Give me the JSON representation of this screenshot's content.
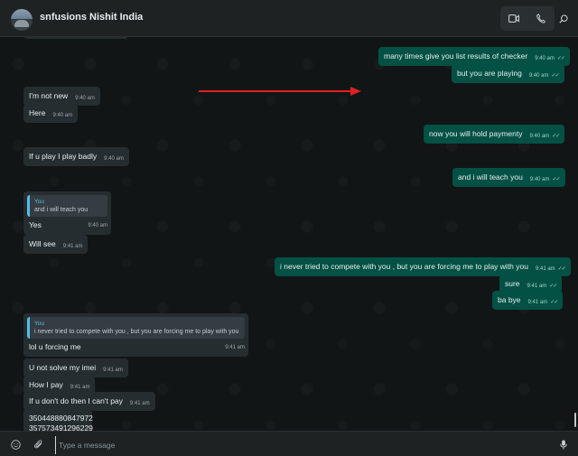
{
  "header": {
    "contact_name": "snfusions Nishit India"
  },
  "composer": {
    "placeholder": "Type a message"
  },
  "messages": [
    {
      "text": "many times give you list results of checker",
      "time": "9:40 am",
      "tick": "✓✓"
    },
    {
      "text": "but you are playing",
      "time": "9:40 am",
      "tick": "✓✓"
    },
    {
      "text": "I'm not  new",
      "time": "9:40 am"
    },
    {
      "text": "Here",
      "time": "9:40 am"
    },
    {
      "text": "now you will hold paymenty",
      "time": "9:40 am",
      "tick": "✓✓"
    },
    {
      "text": "If u play I play badly",
      "time": "9:40 am"
    },
    {
      "text": "and i will teach you",
      "time": "9:40 am",
      "tick": "✓✓"
    },
    {
      "quote_author": "You",
      "quote_text": "and i will teach you",
      "text": "Yes",
      "time": "9:40 am"
    },
    {
      "text": "Will see",
      "time": "9:41 am"
    },
    {
      "text": "i never tried to compete with you , but you are forcing me to play with you",
      "time": "9:41 am",
      "tick": "✓✓"
    },
    {
      "text": "sure",
      "time": "9:41 am",
      "tick": "✓✓"
    },
    {
      "text": "ba bye",
      "time": "9:41 am",
      "tick": "✓✓"
    },
    {
      "quote_author": "You",
      "quote_text": "i never tried to compete with you , but you are forcing me to play with you",
      "text": "lol u forcing me",
      "time": "9:41 am"
    },
    {
      "text": "U not solve my imei",
      "time": "9:41 am"
    },
    {
      "text": "How I pay",
      "time": "9:41 am"
    },
    {
      "text": "If u don't do then I can't pay",
      "time": "9:41 am"
    },
    {
      "line1": "350448880847972",
      "line2": "357573491296229"
    }
  ]
}
